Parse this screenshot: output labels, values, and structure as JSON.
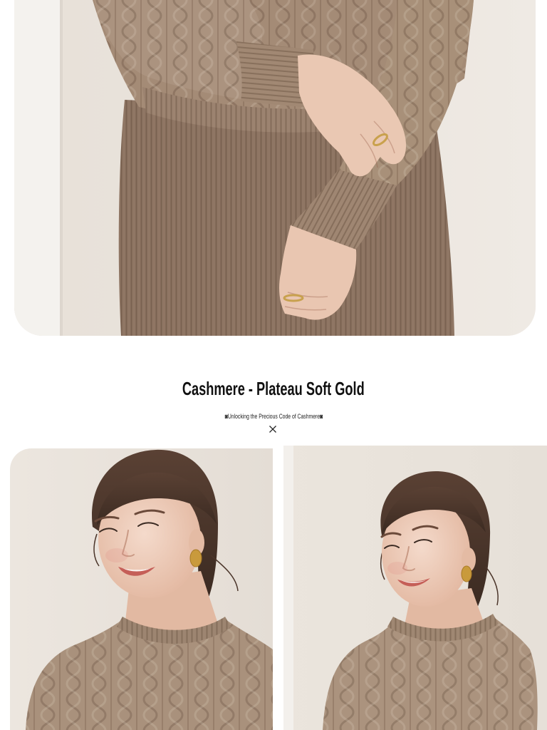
{
  "page": {
    "background": "#ffffff"
  },
  "header": {
    "title": "Cashmere - Plateau Soft Gold",
    "subtitle": "◙Unlocking the Precious Code of Cashmere◙"
  },
  "divider": {
    "icon": "cross-icon"
  },
  "colors": {
    "title_text": "#111111",
    "subtitle_text": "#222222",
    "sweater": "#a48b76",
    "wall": "#ebe5de"
  }
}
